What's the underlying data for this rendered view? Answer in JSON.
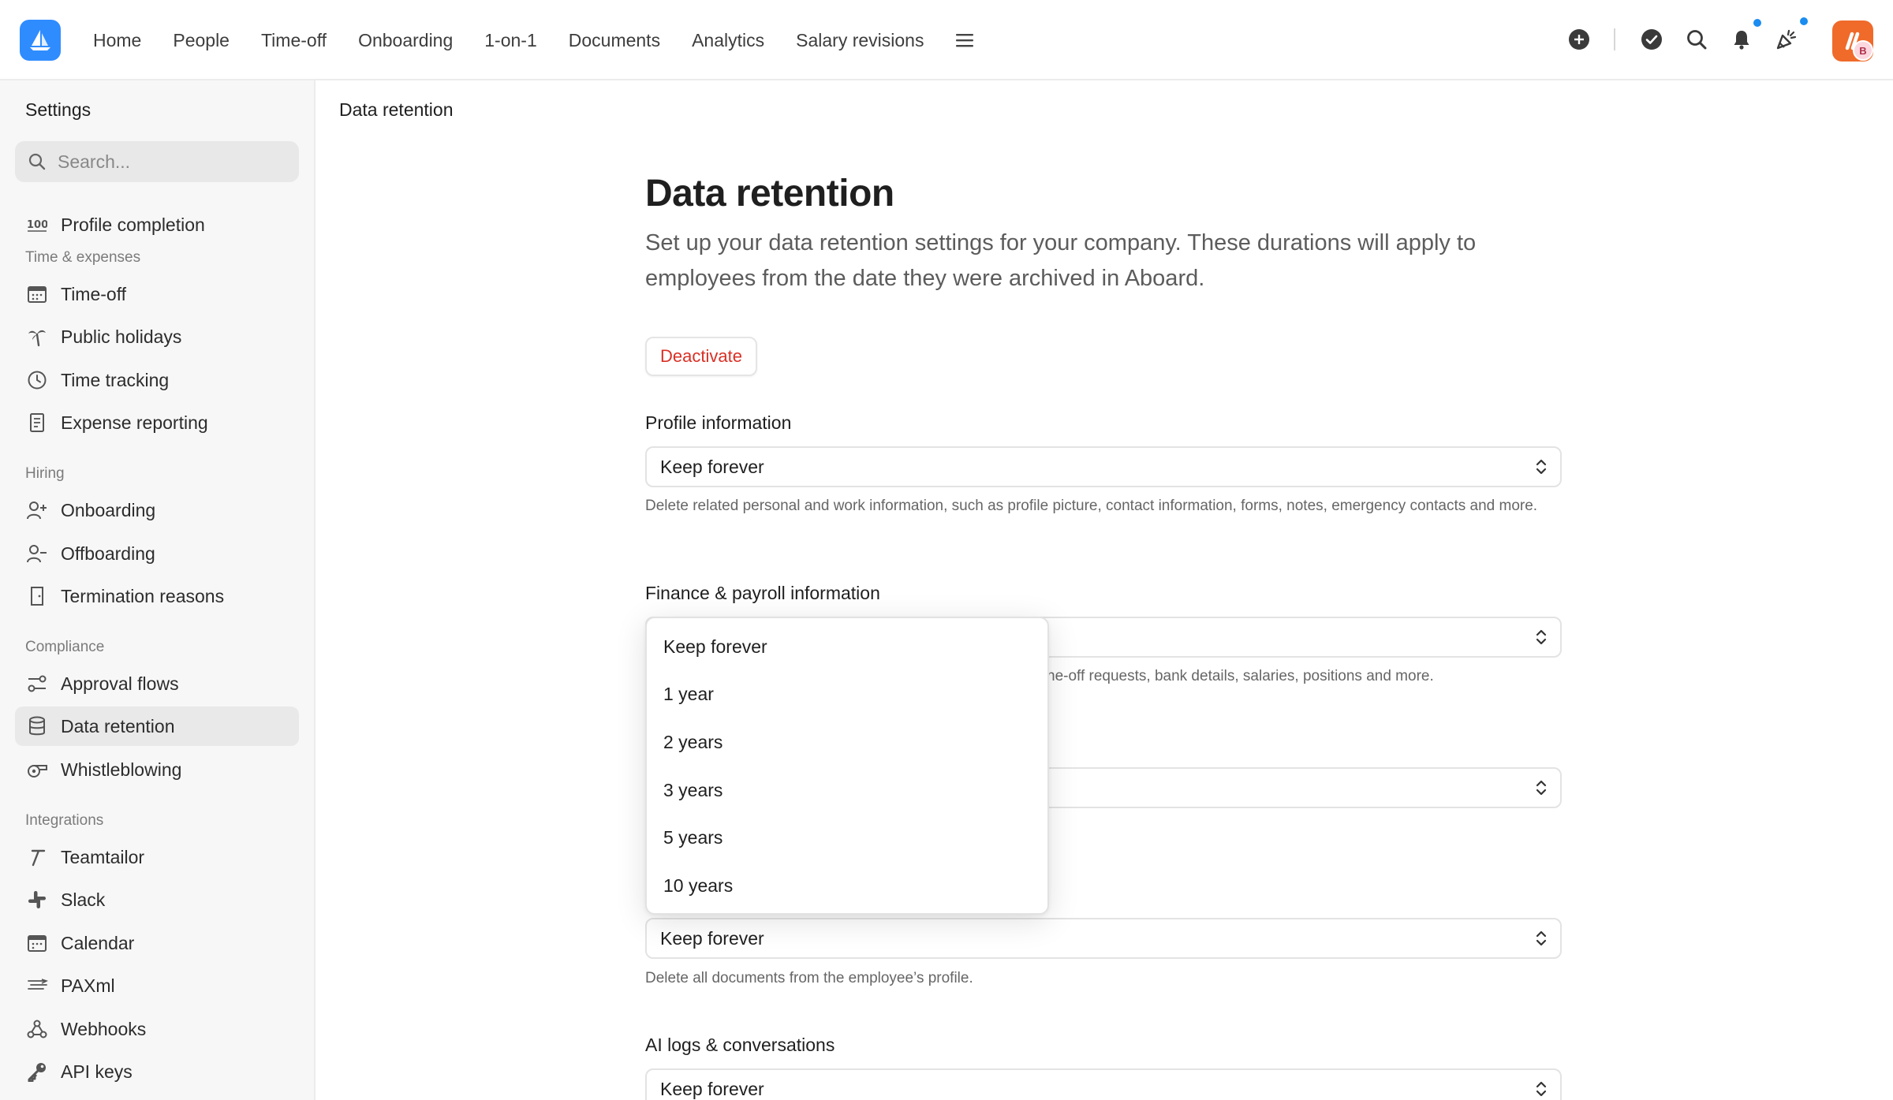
{
  "topbar": {
    "nav": [
      "Home",
      "People",
      "Time-off",
      "Onboarding",
      "1-on-1",
      "Documents",
      "Analytics",
      "Salary revisions"
    ],
    "avatar_badge": "B",
    "accent_color": "#2f8cff",
    "notification_dot_color": "#1b8cf0"
  },
  "sidebar": {
    "title": "Settings",
    "search_placeholder": "Search...",
    "top_items": [
      {
        "label": "Profile completion",
        "icon": "100-icon"
      }
    ],
    "sections": [
      {
        "title": "Time & expenses",
        "items": [
          {
            "label": "Time-off",
            "icon": "calendar-icon"
          },
          {
            "label": "Public holidays",
            "icon": "palm-tree-icon"
          },
          {
            "label": "Time tracking",
            "icon": "clock-icon"
          },
          {
            "label": "Expense reporting",
            "icon": "receipt-icon"
          }
        ]
      },
      {
        "title": "Hiring",
        "items": [
          {
            "label": "Onboarding",
            "icon": "user-plus-icon"
          },
          {
            "label": "Offboarding",
            "icon": "user-minus-icon"
          },
          {
            "label": "Termination reasons",
            "icon": "door-icon"
          }
        ]
      },
      {
        "title": "Compliance",
        "items": [
          {
            "label": "Approval flows",
            "icon": "flow-icon"
          },
          {
            "label": "Data retention",
            "icon": "database-icon",
            "active": true
          },
          {
            "label": "Whistleblowing",
            "icon": "whistle-icon"
          }
        ]
      },
      {
        "title": "Integrations",
        "items": [
          {
            "label": "Teamtailor",
            "icon": "teamtailor-icon"
          },
          {
            "label": "Slack",
            "icon": "slack-icon"
          },
          {
            "label": "Calendar",
            "icon": "calendar-icon"
          },
          {
            "label": "PAXml",
            "icon": "paxml-icon"
          },
          {
            "label": "Webhooks",
            "icon": "webhooks-icon"
          },
          {
            "label": "API keys",
            "icon": "key-icon"
          }
        ]
      }
    ]
  },
  "main": {
    "breadcrumb": "Data retention",
    "title": "Data retention",
    "description": "Set up your data retention settings for your company. These durations will apply to employees from the date they were archived in Aboard.",
    "deactivate_label": "Deactivate",
    "danger_color": "#d93025",
    "fields": [
      {
        "label": "Profile information",
        "value": "Keep forever",
        "help": "Delete related personal and work information, such as profile picture, contact information, forms, notes, emergency contacts and more."
      },
      {
        "label": "Finance & payroll information",
        "value": "",
        "help_visible_fragment": "ne-off requests, bank details, salaries, positions and more."
      },
      {
        "label": "",
        "value": "",
        "help": ""
      },
      {
        "label": "",
        "value": "Keep forever",
        "help": "Delete all documents from the employee’s profile."
      },
      {
        "label": "AI logs & conversations",
        "value": "Keep forever"
      }
    ],
    "dropdown_options": [
      "Keep forever",
      "1 year",
      "2 years",
      "3 years",
      "5 years",
      "10 years"
    ]
  }
}
